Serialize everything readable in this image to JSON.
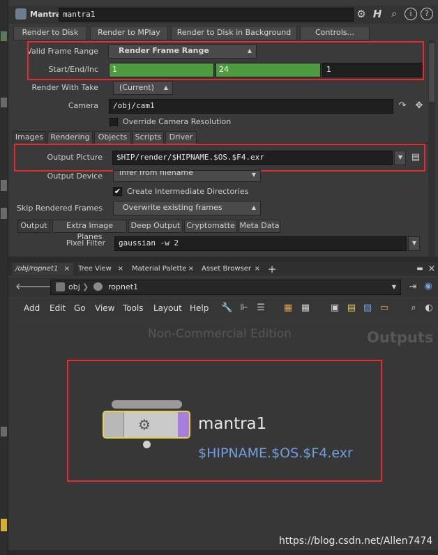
{
  "params": {
    "node_type": "Mantra",
    "node_name": "mantra1",
    "icons": [
      "gear-icon",
      "help-h-icon",
      "search-icon",
      "info-icon",
      "question-icon"
    ],
    "buttons": [
      "Render to Disk",
      "Render to MPlay",
      "Render to Disk in Background",
      "Controls..."
    ],
    "valid_frame_range": {
      "label": "Valid Frame Range",
      "value": "Render Frame Range"
    },
    "start_end_inc": {
      "label": "Start/End/Inc",
      "start": "1",
      "end": "24",
      "inc": "1"
    },
    "render_with_take": {
      "label": "Render With Take",
      "value": "(Current)"
    },
    "camera": {
      "label": "Camera",
      "value": "/obj/cam1"
    },
    "override_camera": {
      "label": "Override Camera Resolution",
      "checked": false
    },
    "tabs": [
      "Images",
      "Rendering",
      "Objects",
      "Scripts",
      "Driver"
    ],
    "output_picture": {
      "label": "Output Picture",
      "value": "$HIP/render/$HIPNAME.$OS.$F4.exr"
    },
    "output_device": {
      "label": "Output Device",
      "value": "Infer from filename"
    },
    "create_dirs": {
      "label": "Create Intermediate Directories",
      "checked": true
    },
    "skip_frames": {
      "label": "Skip Rendered Frames",
      "value": "Overwrite existing frames"
    },
    "subtabs": [
      "Output",
      "Extra Image Planes",
      "Deep Output",
      "Cryptomatte",
      "Meta Data"
    ],
    "pixel_filter": {
      "label": "Pixel Filter",
      "value": "gaussian -w 2"
    }
  },
  "network": {
    "pane_tabs": [
      "/obj/ropnet1",
      "Tree View",
      "Material Palette",
      "Asset Browser"
    ],
    "path": [
      "obj",
      "ropnet1"
    ],
    "menu": [
      "Add",
      "Edit",
      "Go",
      "View",
      "Tools",
      "Layout",
      "Help"
    ],
    "watermark": "Non-Commercial Edition",
    "context_label": "Outputs",
    "node": {
      "name": "mantra1",
      "output": "$HIPNAME.$OS.$F4.exr"
    },
    "credit": "https://blog.csdn.net/Allen7474"
  },
  "colors": {
    "highlight": "#e52b2b",
    "green_field": "#4e9a3e",
    "node_link": "#6fa0e0",
    "node_border": "#e8d34a",
    "node_flag": "#a77ee0"
  }
}
